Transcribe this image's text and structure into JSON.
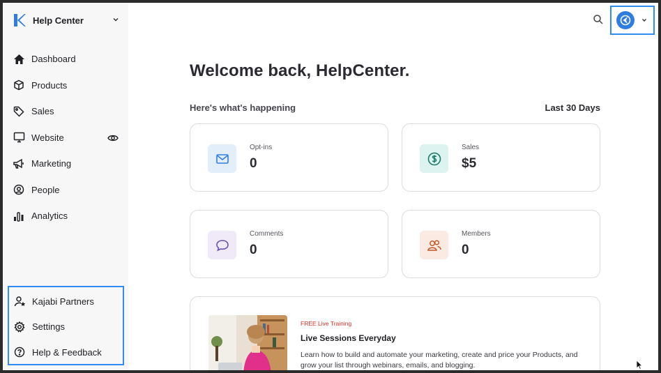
{
  "sidebar": {
    "brand": "Help Center",
    "items": [
      {
        "label": "Dashboard",
        "icon": "home-icon"
      },
      {
        "label": "Products",
        "icon": "cube-icon"
      },
      {
        "label": "Sales",
        "icon": "tag-icon"
      },
      {
        "label": "Website",
        "icon": "monitor-icon"
      },
      {
        "label": "Marketing",
        "icon": "megaphone-icon"
      },
      {
        "label": "People",
        "icon": "at-circle-icon"
      },
      {
        "label": "Analytics",
        "icon": "bar-chart-icon"
      }
    ],
    "bottom_items": [
      {
        "label": "Kajabi Partners",
        "icon": "person-star-icon"
      },
      {
        "label": "Settings",
        "icon": "gear-icon"
      },
      {
        "label": "Help & Feedback",
        "icon": "question-circle-icon"
      }
    ]
  },
  "header": {
    "title": "Welcome back, HelpCenter.",
    "subtitle": "Here's what's happening",
    "range": "Last 30 Days"
  },
  "stats": [
    {
      "label": "Opt-ins",
      "value": "0",
      "icon": "mail-icon",
      "color": "#2f7de0",
      "bg": "#e3eefb"
    },
    {
      "label": "Sales",
      "value": "$5",
      "icon": "dollar-circle-icon",
      "color": "#1d7a6c",
      "bg": "#dcf3ef"
    },
    {
      "label": "Comments",
      "value": "0",
      "icon": "chat-bubble-icon",
      "color": "#6b4fb8",
      "bg": "#efe9f8"
    },
    {
      "label": "Members",
      "value": "0",
      "icon": "members-icon",
      "color": "#c2572a",
      "bg": "#fbeae2"
    }
  ],
  "promo": {
    "tag": "FREE Live Training",
    "title": "Live Sessions Everyday",
    "description": "Learn how to build and automate your marketing, create and price your Products, and grow your list through webinars, emails, and blogging."
  },
  "colors": {
    "accent": "#2f8cf0",
    "sidebar_bg": "#f7f7f8"
  }
}
